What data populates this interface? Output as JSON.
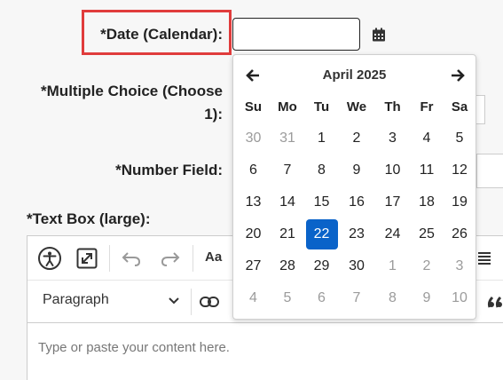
{
  "form": {
    "date_label": "*Date (Calendar):",
    "mc_label_line1": "*Multiple Choice (Choose",
    "mc_label_line2": "1):",
    "number_label": "*Number Field:",
    "textbox_label": "*Text Box (large):"
  },
  "editor": {
    "paragraph_label": "Paragraph",
    "font_size_label": "Aa",
    "placeholder": "Type or paste your content here.",
    "icons": [
      "accessibility-icon",
      "fullscreen-icon",
      "undo-icon",
      "redo-icon",
      "font-size-icon",
      "list-icon",
      "link-icon",
      "blockquote-icon"
    ]
  },
  "calendar": {
    "month_title": "April 2025",
    "weekdays": [
      "Su",
      "Mo",
      "Tu",
      "We",
      "Th",
      "Fr",
      "Sa"
    ],
    "selected_day": "22",
    "weeks": [
      [
        {
          "d": "30",
          "o": true
        },
        {
          "d": "31",
          "o": true
        },
        {
          "d": "1",
          "o": false
        },
        {
          "d": "2",
          "o": false
        },
        {
          "d": "3",
          "o": false
        },
        {
          "d": "4",
          "o": false
        },
        {
          "d": "5",
          "o": false
        }
      ],
      [
        {
          "d": "6",
          "o": false
        },
        {
          "d": "7",
          "o": false
        },
        {
          "d": "8",
          "o": false
        },
        {
          "d": "9",
          "o": false
        },
        {
          "d": "10",
          "o": false
        },
        {
          "d": "11",
          "o": false
        },
        {
          "d": "12",
          "o": false
        }
      ],
      [
        {
          "d": "13",
          "o": false
        },
        {
          "d": "14",
          "o": false
        },
        {
          "d": "15",
          "o": false
        },
        {
          "d": "16",
          "o": false
        },
        {
          "d": "17",
          "o": false
        },
        {
          "d": "18",
          "o": false
        },
        {
          "d": "19",
          "o": false
        }
      ],
      [
        {
          "d": "20",
          "o": false
        },
        {
          "d": "21",
          "o": false
        },
        {
          "d": "22",
          "o": false
        },
        {
          "d": "23",
          "o": false
        },
        {
          "d": "24",
          "o": false
        },
        {
          "d": "25",
          "o": false
        },
        {
          "d": "26",
          "o": false
        }
      ],
      [
        {
          "d": "27",
          "o": false
        },
        {
          "d": "28",
          "o": false
        },
        {
          "d": "29",
          "o": false
        },
        {
          "d": "30",
          "o": false
        },
        {
          "d": "1",
          "o": true
        },
        {
          "d": "2",
          "o": true
        },
        {
          "d": "3",
          "o": true
        }
      ],
      [
        {
          "d": "4",
          "o": true
        },
        {
          "d": "5",
          "o": true
        },
        {
          "d": "6",
          "o": true
        },
        {
          "d": "7",
          "o": true
        },
        {
          "d": "8",
          "o": true
        },
        {
          "d": "9",
          "o": true
        },
        {
          "d": "10",
          "o": true
        }
      ]
    ]
  },
  "colors": {
    "highlight": "#e03c3c",
    "selected_day_bg": "#0a63c9",
    "other_month_text": "#9b9b9b"
  }
}
